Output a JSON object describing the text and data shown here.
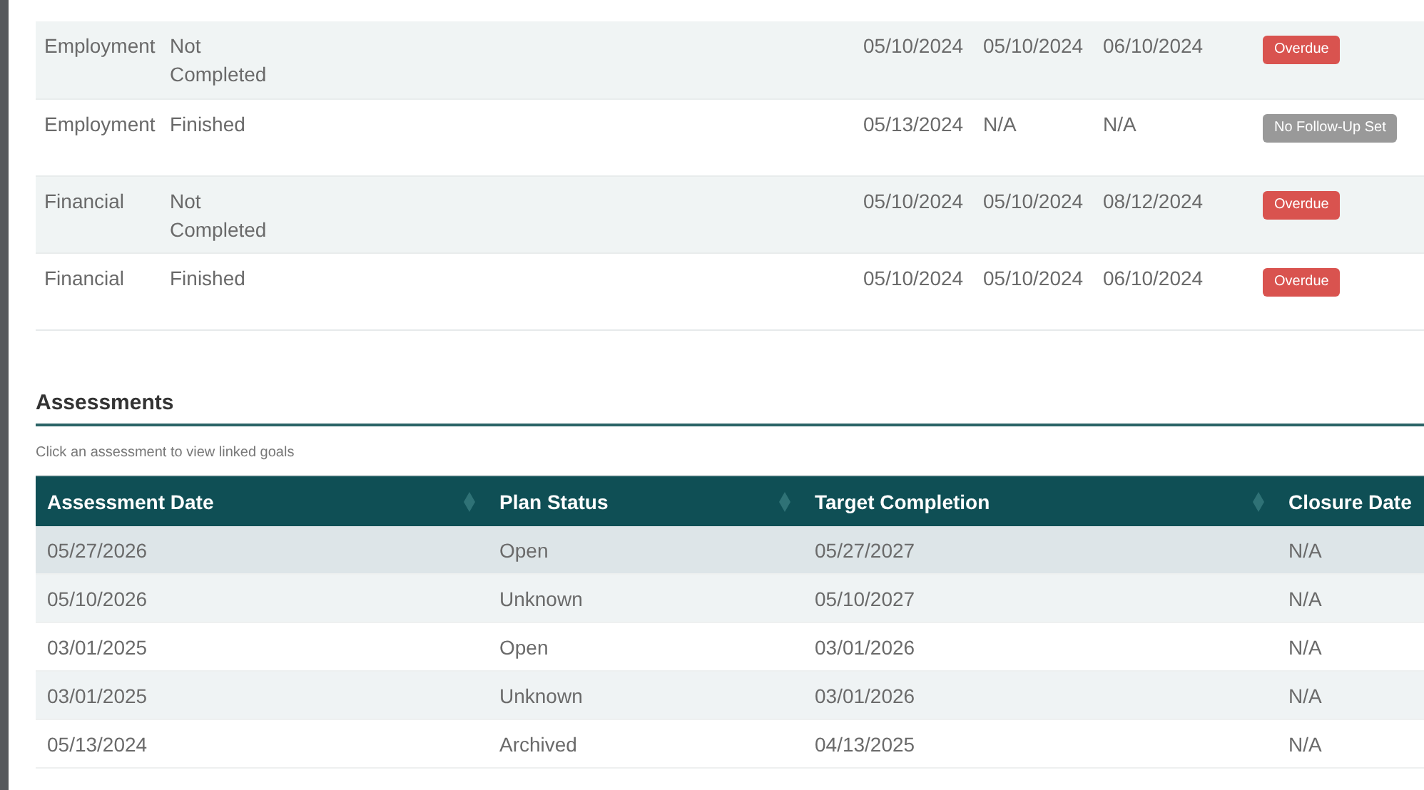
{
  "goals_table": {
    "rows": [
      {
        "cells": [
          "Employment",
          "Not Completed",
          "05/10/2024",
          "05/10/2024",
          "06/10/2024"
        ],
        "badge": {
          "label": "Overdue",
          "kind": "overdue"
        }
      },
      {
        "cells": [
          "Employment",
          "Finished",
          "05/13/2024",
          "N/A",
          "N/A"
        ],
        "badge": {
          "label": "No Follow-Up Set",
          "kind": "none"
        }
      },
      {
        "cells": [
          "Financial",
          "Not Completed",
          "05/10/2024",
          "05/10/2024",
          "08/12/2024"
        ],
        "badge": {
          "label": "Overdue",
          "kind": "overdue"
        }
      },
      {
        "cells": [
          "Financial",
          "Finished",
          "05/10/2024",
          "05/10/2024",
          "06/10/2024"
        ],
        "badge": {
          "label": "Overdue",
          "kind": "overdue"
        }
      }
    ]
  },
  "assessments": {
    "title": "Assessments",
    "hint": "Click an assessment to view linked goals",
    "columns": [
      "Assessment Date",
      "Plan Status",
      "Target Completion",
      "Closure Date"
    ],
    "rows": [
      {
        "cells": [
          "05/27/2026",
          "Open",
          "05/27/2027",
          "N/A"
        ],
        "hovered": true
      },
      {
        "cells": [
          "05/10/2026",
          "Unknown",
          "05/10/2027",
          "N/A"
        ],
        "hovered": false
      },
      {
        "cells": [
          "03/01/2025",
          "Open",
          "03/01/2026",
          "N/A"
        ],
        "hovered": false
      },
      {
        "cells": [
          "03/01/2025",
          "Unknown",
          "03/01/2026",
          "N/A"
        ],
        "hovered": false
      },
      {
        "cells": [
          "05/13/2024",
          "Archived",
          "04/13/2025",
          "N/A"
        ],
        "hovered": false
      }
    ]
  }
}
